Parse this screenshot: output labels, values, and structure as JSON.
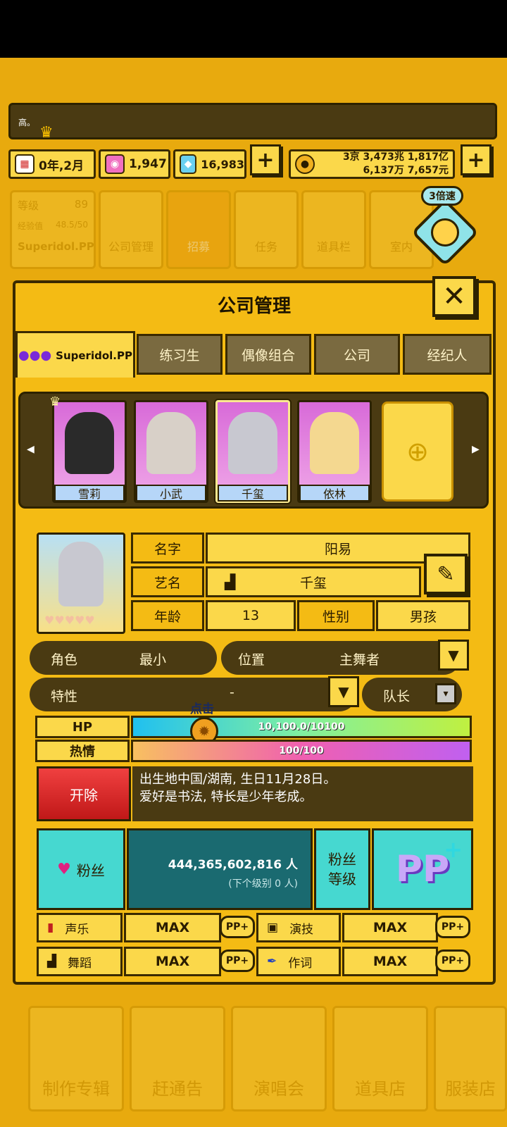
{
  "ticker": {
    "text": "高。"
  },
  "resources": {
    "date": "0年,2月",
    "gems_pink": "1,947",
    "diamonds": "16,983",
    "money_line1": "3京 3,473兆 1,817亿",
    "money_line2": "6,137万 7,657元"
  },
  "background_menu": {
    "level_label": "等级",
    "level_value": "89",
    "exp_label": "经验值",
    "exp_value": "48.5/50",
    "company_name": "Superidol.PP",
    "items": [
      "公司管理",
      "招募",
      "任务",
      "道具栏",
      "室内"
    ]
  },
  "speed_badge": "3倍速",
  "panel": {
    "title": "公司管理",
    "tabs": [
      "Superidol.PP",
      "练习生",
      "偶像组合",
      "公司",
      "经纪人"
    ]
  },
  "members": [
    {
      "name": "雪莉",
      "icon": "member-avatar"
    },
    {
      "name": "小武",
      "icon": "member-avatar"
    },
    {
      "name": "千玺",
      "icon": "member-avatar"
    },
    {
      "name": "依林",
      "icon": "member-avatar"
    }
  ],
  "profile": {
    "name_label": "名字",
    "name_value": "阳易",
    "stage_label": "艺名",
    "stage_value": "千玺",
    "age_label": "年龄",
    "age_value": "13",
    "gender_label": "性别",
    "gender_value": "男孩",
    "role_label": "角色",
    "role_value": "最小",
    "position_label": "位置",
    "position_value": "主舞者",
    "trait_label": "特性",
    "trait_value": "-",
    "leader_label": "队长"
  },
  "stats": {
    "tap_hint": "点击",
    "hp_label": "HP",
    "hp_text": "10,100.0/10100",
    "hp_fraction": 1.0,
    "passion_label": "热情",
    "passion_text": "100/100",
    "passion_fraction": 1.0
  },
  "fire_button": "开除",
  "bio": {
    "line1": "出生地中国/湖南, 生日11月28日。",
    "line2": "爱好是书法, 特长是少年老成。"
  },
  "fans": {
    "label": "粉丝",
    "count": "444,365,602,816 人",
    "next_level": "(下个级别 0 人)",
    "level_label_1": "粉丝",
    "level_label_2": "等级"
  },
  "skills": [
    {
      "name": "声乐",
      "value": "MAX",
      "btn": "PP+"
    },
    {
      "name": "演技",
      "value": "MAX",
      "btn": "PP+"
    },
    {
      "name": "舞蹈",
      "value": "MAX",
      "btn": "PP+"
    },
    {
      "name": "作词",
      "value": "MAX",
      "btn": "PP+"
    }
  ],
  "bottom_nav": [
    "制作专辑",
    "赶通告",
    "演唱会",
    "道具店",
    "服装店"
  ],
  "colors": {
    "game_bg": "#e8aa0e",
    "panel_bg": "#f4bb14",
    "tile": "#fbd84a",
    "dark": "#4a3a12",
    "teal": "#46d8d0",
    "fire": "#d02020"
  }
}
